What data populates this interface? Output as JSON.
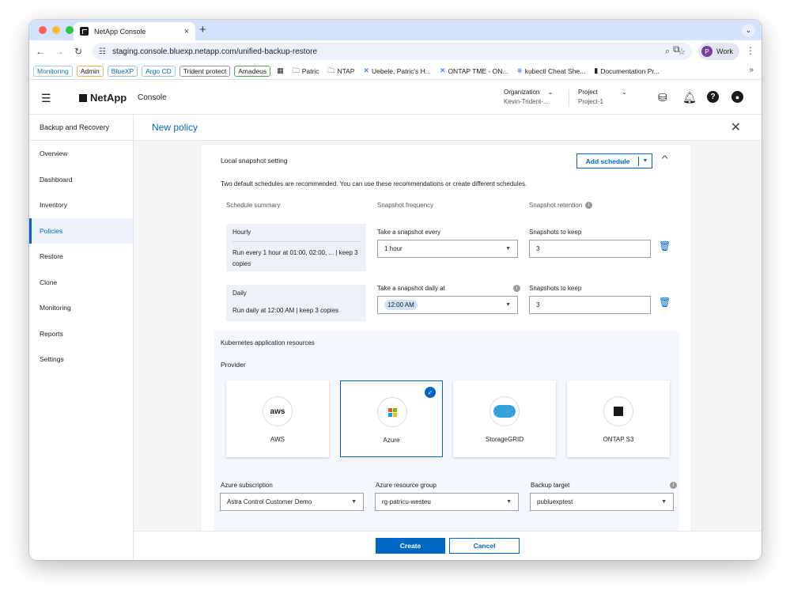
{
  "browser": {
    "tab_title": "NetApp Console",
    "tab_close": "×",
    "new_tab": "+",
    "url": "staging.console.bluexp.netapp.com/unified-backup-restore",
    "profile_initial": "P",
    "profile_name": "Work",
    "bookmarks": [
      "Monitoring",
      "Admin",
      "BlueXP",
      "Argo CD",
      "Trident protect",
      "Amadeus",
      "Patric",
      "NTAP",
      "Uebele, Patric's H...",
      "ONTAP TME - ON...",
      "kubectl Cheat She...",
      "Documentation Pr..."
    ],
    "bookmarks_more": "»"
  },
  "app_header": {
    "brand": "NetApp",
    "console": "Console",
    "org_label": "Organization",
    "org_value": "Kevin-Trident-...",
    "project_label": "Project",
    "project_value": "Project-1"
  },
  "sidebar": {
    "title": "Backup and Recovery",
    "items": [
      "Overview",
      "Dashboard",
      "Inventory",
      "Policies",
      "Restore",
      "Clone",
      "Monitoring",
      "Reports",
      "Settings"
    ]
  },
  "page": {
    "title": "New policy",
    "close": "✕"
  },
  "snapshot": {
    "section_title": "Local snapshot setting",
    "add_schedule": "Add schedule",
    "intro": "Two default schedules are recommended. You can use these recommendations or create different schedules.",
    "col_summary": "Schedule summary",
    "col_frequency": "Snapshot frequency",
    "col_retention": "Snapshot retention",
    "hourly": {
      "title": "Hourly",
      "summary": "Run every 1 hour at 01:00, 02:00, ... | keep 3 copies",
      "freq_label": "Take a snapshot every",
      "freq_value": "1 hour",
      "keep_label": "Snapshots to keep",
      "keep_value": "3"
    },
    "daily": {
      "title": "Daily",
      "summary": "Run daily at 12:00 AM | keep 3 copies",
      "freq_label": "Take a snapshot daily at",
      "freq_value": "12:00 AM",
      "keep_label": "Snapshots to keep",
      "keep_value": "3"
    }
  },
  "k8s": {
    "title": "Kubernetes application resources",
    "provider_label": "Provider",
    "providers": [
      "AWS",
      "Azure",
      "StorageGRID",
      "ONTAP S3"
    ],
    "aws_logo": "aws",
    "subscription_label": "Azure subscription",
    "subscription_value": "Astra Control Customer Demo",
    "resource_group_label": "Azure resource group",
    "resource_group_value": "rg-patricu-westeu",
    "backup_target_label": "Backup target",
    "backup_target_value": "publuexptest"
  },
  "footer": {
    "create": "Create",
    "cancel": "Cancel"
  },
  "colors": {
    "accent": "#0067c5",
    "tabstrip": "#d3e3fd"
  }
}
